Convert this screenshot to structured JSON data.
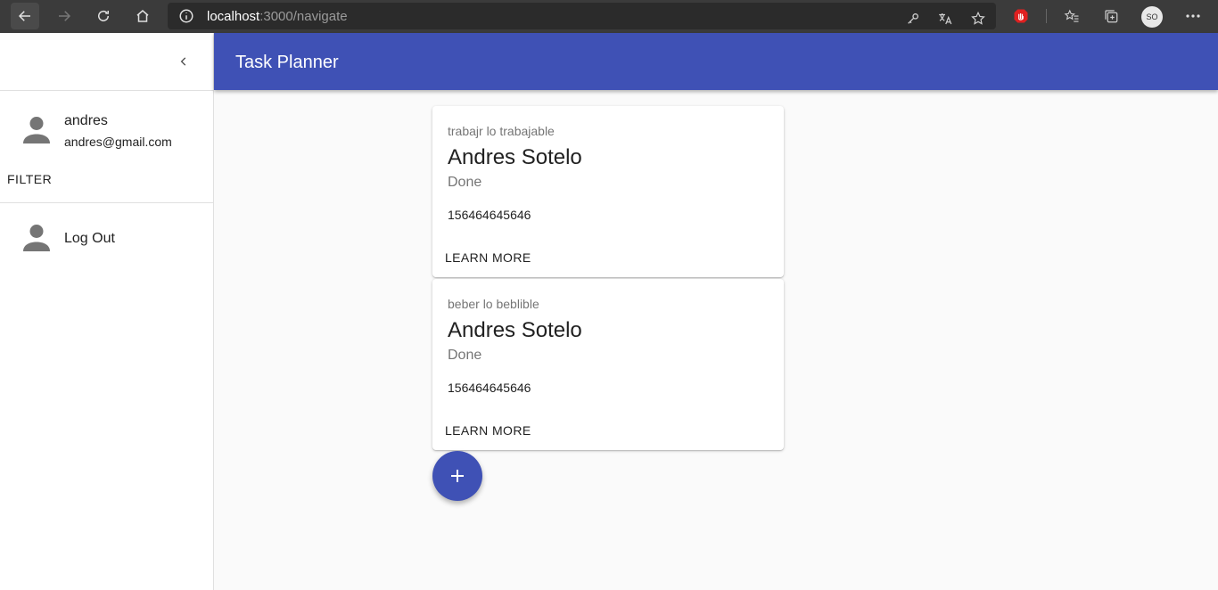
{
  "browser": {
    "url_host": "localhost",
    "url_path": ":3000/navigate",
    "profile_initials": "SO"
  },
  "sidebar": {
    "user_name": "andres",
    "user_email": "andres@gmail.com",
    "filter_label": "FILTER",
    "logout_label": "Log Out"
  },
  "appbar": {
    "title": "Task Planner"
  },
  "tasks": [
    {
      "description": "trabajr lo trabajable",
      "responsible": "Andres Sotelo",
      "status": "Done",
      "due_date": "156464645646",
      "action_label": "LEARN MORE"
    },
    {
      "description": "beber lo beblible",
      "responsible": "Andres Sotelo",
      "status": "Done",
      "due_date": "156464645646",
      "action_label": "LEARN MORE"
    }
  ],
  "colors": {
    "primary": "#3f51b5",
    "background": "#fafafa"
  }
}
